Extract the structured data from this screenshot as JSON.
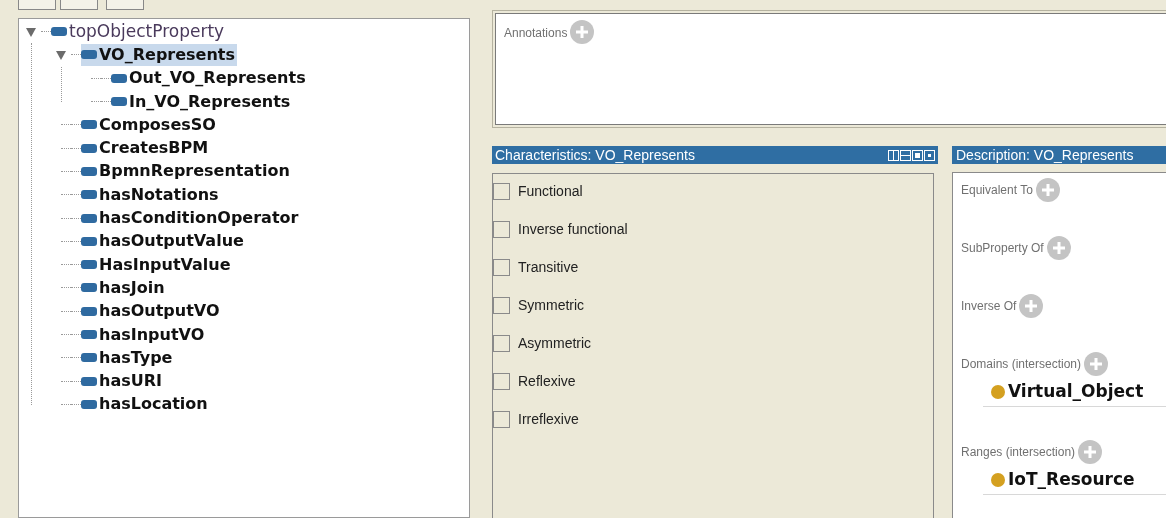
{
  "tree": [
    {
      "label": "topObjectProperty",
      "expanded": true,
      "selected": false,
      "children": [
        {
          "label": "VO_Represents",
          "expanded": true,
          "selected": true,
          "children": [
            {
              "label": "Out_VO_Represents",
              "selected": false
            },
            {
              "label": "In_VO_Represents",
              "selected": false
            }
          ]
        },
        {
          "label": "ComposesSO",
          "selected": false
        },
        {
          "label": "CreatesBPM",
          "selected": false
        },
        {
          "label": "BpmnRepresentation",
          "selected": false
        },
        {
          "label": "hasNotations",
          "selected": false
        },
        {
          "label": "hasConditionOperator",
          "selected": false
        },
        {
          "label": "hasOutputValue",
          "selected": false
        },
        {
          "label": "HasInputValue",
          "selected": false
        },
        {
          "label": "hasJoin",
          "selected": false
        },
        {
          "label": "hasOutputVO",
          "selected": false
        },
        {
          "label": "hasInputVO",
          "selected": false
        },
        {
          "label": "hasType",
          "selected": false
        },
        {
          "label": "hasURI",
          "selected": false
        },
        {
          "label": "hasLocation",
          "selected": false
        }
      ]
    }
  ],
  "annotations": {
    "label": "Annotations"
  },
  "characteristics": {
    "title": "Characteristics: VO_Represents",
    "options": [
      {
        "label": "Functional",
        "checked": false
      },
      {
        "label": "Inverse functional",
        "checked": false
      },
      {
        "label": "Transitive",
        "checked": false
      },
      {
        "label": "Symmetric",
        "checked": false
      },
      {
        "label": "Asymmetric",
        "checked": false
      },
      {
        "label": "Reflexive",
        "checked": false
      },
      {
        "label": "Irreflexive",
        "checked": false
      }
    ]
  },
  "description": {
    "title": "Description: VO_Represents",
    "sections": [
      {
        "label": "Equivalent To"
      },
      {
        "label": "SubProperty Of"
      },
      {
        "label": "Inverse Of"
      },
      {
        "label": "Domains (intersection)",
        "items": [
          {
            "label": "Virtual_Object",
            "color": "#d4a020"
          }
        ]
      },
      {
        "label": "Ranges (intersection)",
        "items": [
          {
            "label": "IoT_Resource",
            "color": "#d4a020"
          }
        ]
      }
    ]
  }
}
